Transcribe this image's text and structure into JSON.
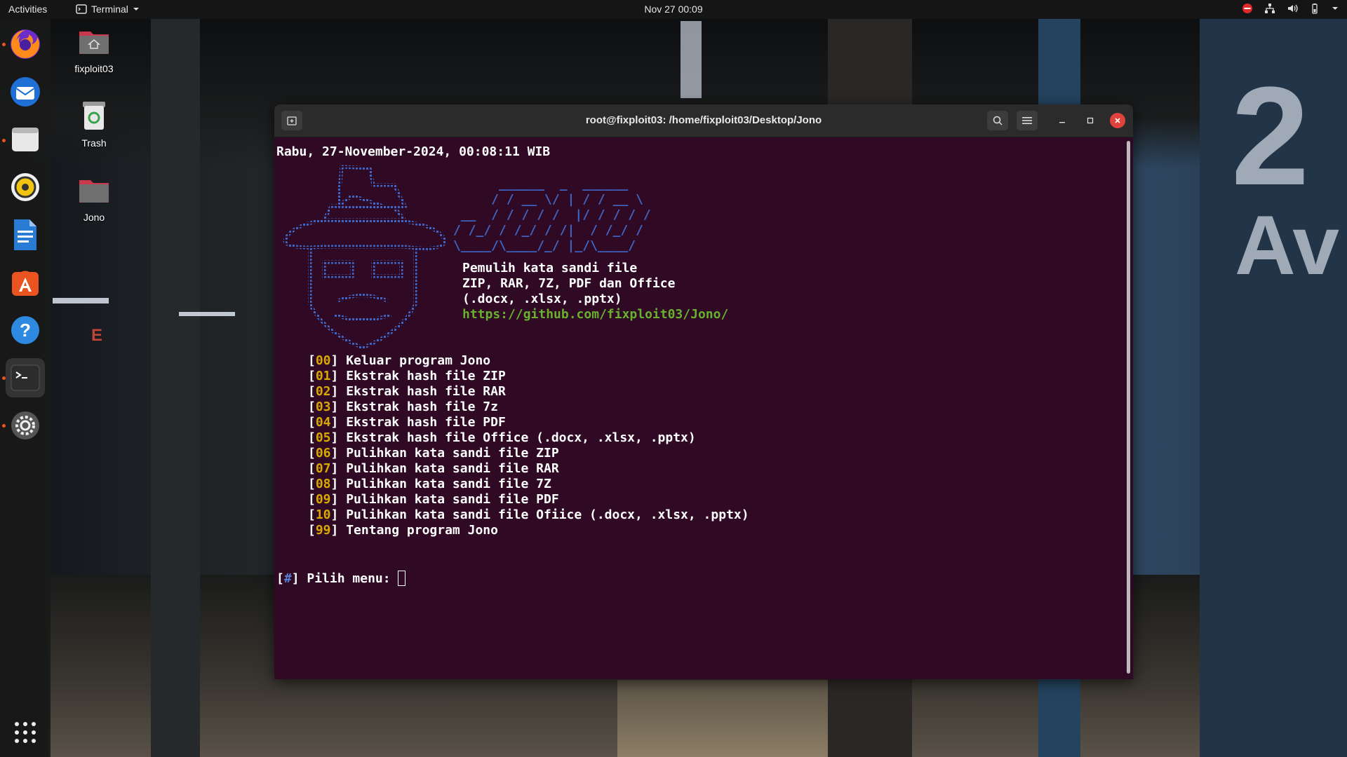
{
  "topbar": {
    "activities": "Activities",
    "app_menu": "Terminal",
    "clock": "Nov 27  00:09"
  },
  "dock": {
    "items": [
      {
        "icon": "firefox-icon"
      },
      {
        "icon": "thunderbird-icon"
      },
      {
        "icon": "files-icon"
      },
      {
        "icon": "rhythmbox-icon"
      },
      {
        "icon": "libreoffice-writer-icon"
      },
      {
        "icon": "software-center-icon"
      },
      {
        "icon": "help-icon"
      },
      {
        "icon": "terminal-icon"
      },
      {
        "icon": "settings-icon"
      },
      {
        "icon": "show-apps-icon"
      }
    ]
  },
  "desktop": {
    "icons": [
      {
        "label": "fixploit03"
      },
      {
        "label": "Trash"
      },
      {
        "label": "Jono"
      }
    ]
  },
  "wallpaper": {
    "sign_big": "2",
    "sign_text": "Av",
    "small_sign": "E"
  },
  "terminal": {
    "title": "root@fixploit03: /home/fixploit03/Desktop/Jono",
    "date_line": "Rabu, 27-November-2024, 00:08:11 WIB",
    "ascii_logo": [
      "      ______  _  ______",
      "     / / __ \\/ | / / __ \\",
      " __  / / / / /  |/ / / / /",
      "/ /_/ / /_/ / /|  / /_/ /",
      "\\____/\\____/_/ |_/\\____/"
    ],
    "tagline": "Pemulih kata sandi file",
    "formats": "ZIP, RAR, 7Z, PDF dan Office",
    "office_ext": "(.docx, .xlsx, .pptx)",
    "url": "https://github.com/fixploit03/Jono/",
    "menu": [
      {
        "num": "00",
        "label": "Keluar program Jono"
      },
      {
        "num": "01",
        "label": "Ekstrak hash file ZIP"
      },
      {
        "num": "02",
        "label": "Ekstrak hash file RAR"
      },
      {
        "num": "03",
        "label": "Ekstrak hash file 7z"
      },
      {
        "num": "04",
        "label": "Ekstrak hash file PDF"
      },
      {
        "num": "05",
        "label": "Ekstrak hash file Office (.docx, .xlsx, .pptx)"
      },
      {
        "num": "06",
        "label": "Pulihkan kata sandi file ZIP"
      },
      {
        "num": "07",
        "label": "Pulihkan kata sandi file RAR"
      },
      {
        "num": "08",
        "label": "Pulihkan kata sandi file 7Z"
      },
      {
        "num": "09",
        "label": "Pulihkan kata sandi file PDF"
      },
      {
        "num": "10",
        "label": "Pulihkan kata sandi file Ofiice (.docx, .xlsx, .pptx)"
      },
      {
        "num": "99",
        "label": "Tentang program Jono"
      }
    ],
    "prompt_symbol": "#",
    "prompt_label": "Pilih menu: "
  },
  "colors": {
    "terminal_bg": "#300a24",
    "menu_number": "#d9a800",
    "ascii": "#3d66c7",
    "url": "#67b12e",
    "close_button": "#e0433b"
  }
}
